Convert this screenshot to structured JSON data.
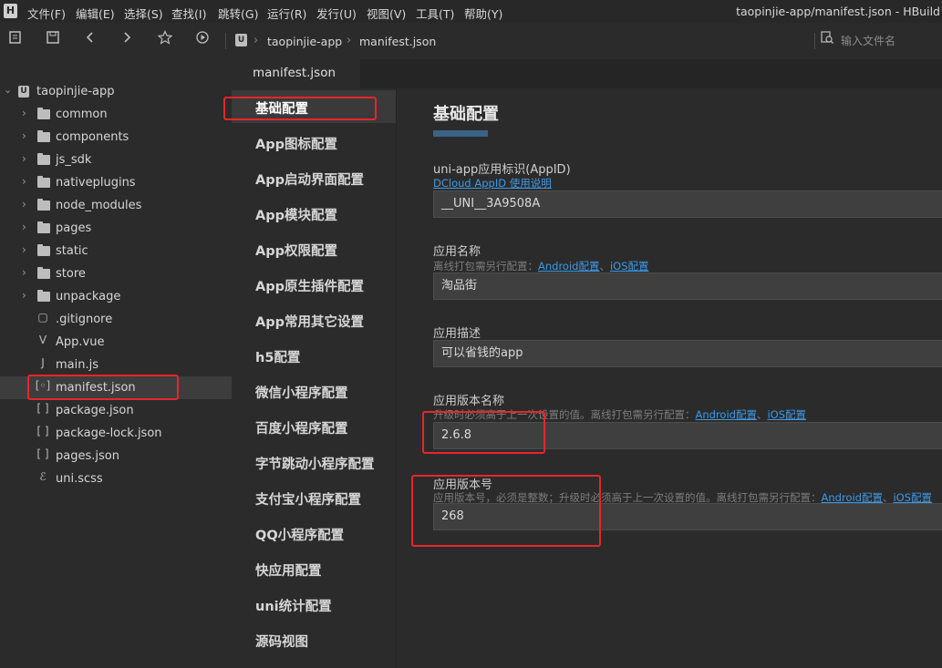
{
  "app": {
    "logo_text": "H",
    "window_title": "taopinjie-app/manifest.json - HBuild",
    "menu": [
      "文件(F)",
      "编辑(E)",
      "选择(S)",
      "查找(I)",
      "跳转(G)",
      "运行(R)",
      "发行(U)",
      "视图(V)",
      "工具(T)",
      "帮助(Y)"
    ]
  },
  "toolbar": {
    "icons": [
      "save-all-icon",
      "save-icon",
      "back-icon",
      "forward-icon",
      "star-icon",
      "run-icon"
    ],
    "project_icon_text": "U",
    "breadcrumb": [
      "taopinjie-app",
      "manifest.json"
    ],
    "search_placeholder": "输入文件名"
  },
  "sidebar": {
    "project_name": "taopinjie-app",
    "project_icon_text": "U",
    "items": [
      {
        "label": "common",
        "type": "folder"
      },
      {
        "label": "components",
        "type": "folder"
      },
      {
        "label": "js_sdk",
        "type": "folder"
      },
      {
        "label": "nativeplugins",
        "type": "folder"
      },
      {
        "label": "node_modules",
        "type": "folder"
      },
      {
        "label": "pages",
        "type": "folder"
      },
      {
        "label": "static",
        "type": "folder"
      },
      {
        "label": "store",
        "type": "folder"
      },
      {
        "label": "unpackage",
        "type": "folder"
      },
      {
        "label": ".gitignore",
        "type": "file",
        "glyph": "▢"
      },
      {
        "label": "App.vue",
        "type": "file",
        "glyph": "V"
      },
      {
        "label": "main.js",
        "type": "file",
        "glyph": "J"
      },
      {
        "label": "manifest.json",
        "type": "file",
        "glyph": "[◦]",
        "active": true
      },
      {
        "label": "package.json",
        "type": "file",
        "glyph": "[ ]"
      },
      {
        "label": "package-lock.json",
        "type": "file",
        "glyph": "[ ]"
      },
      {
        "label": "pages.json",
        "type": "file",
        "glyph": "[ ]"
      },
      {
        "label": "uni.scss",
        "type": "file",
        "glyph": "ℰ"
      }
    ]
  },
  "editor": {
    "tab_label": "manifest.json"
  },
  "settings_nav": [
    {
      "label": "基础配置",
      "active": true
    },
    {
      "label": "App图标配置"
    },
    {
      "label": "App启动界面配置"
    },
    {
      "label": "App模块配置"
    },
    {
      "label": "App权限配置"
    },
    {
      "label": "App原生插件配置"
    },
    {
      "label": "App常用其它设置"
    },
    {
      "label": "h5配置"
    },
    {
      "label": "微信小程序配置"
    },
    {
      "label": "百度小程序配置"
    },
    {
      "label": "字节跳动小程序配置"
    },
    {
      "label": "支付宝小程序配置"
    },
    {
      "label": "QQ小程序配置"
    },
    {
      "label": "快应用配置"
    },
    {
      "label": "uni统计配置"
    },
    {
      "label": "源码视图"
    }
  ],
  "main": {
    "heading": "基础配置",
    "appid": {
      "label": "uni-app应用标识(AppID)",
      "link": "DCloud AppID 使用说明",
      "value": "__UNI__3A9508A"
    },
    "app_name": {
      "label": "应用名称",
      "hint": "离线打包需另行配置：",
      "link_android": "Android配置",
      "hint_sep": "、",
      "link_ios": "iOS配置",
      "value": "淘品街"
    },
    "app_desc": {
      "label": "应用描述",
      "value": "可以省钱的app"
    },
    "version_name": {
      "label": "应用版本名称",
      "hint": "升级时必须高于上一次设置的值。离线打包需另行配置：",
      "link_android": "Android配置",
      "hint_sep": "、",
      "link_ios": "iOS配置",
      "value": "2.6.8"
    },
    "version_code": {
      "label": "应用版本号",
      "hint": "应用版本号，必须是整数；升级时必须高于上一次设置的值。离线打包需另行配置：",
      "link_android": "Android配置",
      "hint_sep": "、",
      "link_ios": "iOS配置",
      "value": "268"
    }
  },
  "colors": {
    "highlight": "#e8262a",
    "link": "#3c9ae8",
    "background": "#2b2b2b"
  }
}
